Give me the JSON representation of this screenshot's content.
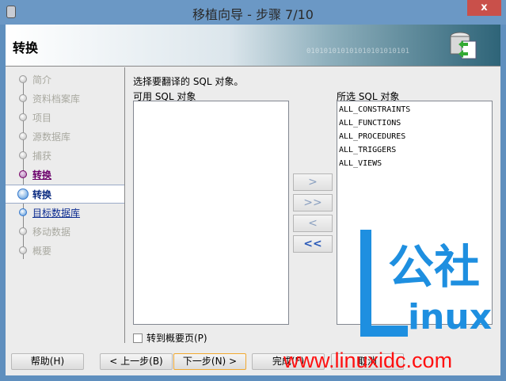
{
  "window": {
    "title": "移植向导 - 步骤 7/10",
    "close": "x"
  },
  "header": {
    "title": "转换",
    "binary": "010101010101010101010101"
  },
  "steps": [
    {
      "label": "简介",
      "state": "disabled"
    },
    {
      "label": "资料档案库",
      "state": "disabled"
    },
    {
      "label": "项目",
      "state": "disabled"
    },
    {
      "label": "源数据库",
      "state": "disabled"
    },
    {
      "label": "捕获",
      "state": "disabled"
    },
    {
      "label": "转换",
      "state": "visited"
    },
    {
      "label": "转换",
      "state": "current"
    },
    {
      "label": "目标数据库",
      "state": "next"
    },
    {
      "label": "移动数据",
      "state": "disabled"
    },
    {
      "label": "概要",
      "state": "disabled"
    }
  ],
  "main": {
    "instruction": "选择要翻译的 SQL 对象。",
    "available_label": "可用 SQL 对象",
    "selected_label": "所选 SQL 对象",
    "available": [],
    "selected": [
      "ALL_CONSTRAINTS",
      "ALL_FUNCTIONS",
      "ALL_PROCEDURES",
      "ALL_TRIGGERS",
      "ALL_VIEWS"
    ],
    "move_buttons": [
      ">",
      ">>",
      "<",
      "<<"
    ],
    "goto_summary": "转到概要页(P)"
  },
  "buttons": {
    "help": "帮助(H)",
    "back": "< 上一步(B)",
    "next": "下一步(N) >",
    "finish": "完成(F)",
    "cancel": "取消"
  },
  "watermark": {
    "logo": "L公社inux",
    "url": "www.linuxidc.com"
  }
}
